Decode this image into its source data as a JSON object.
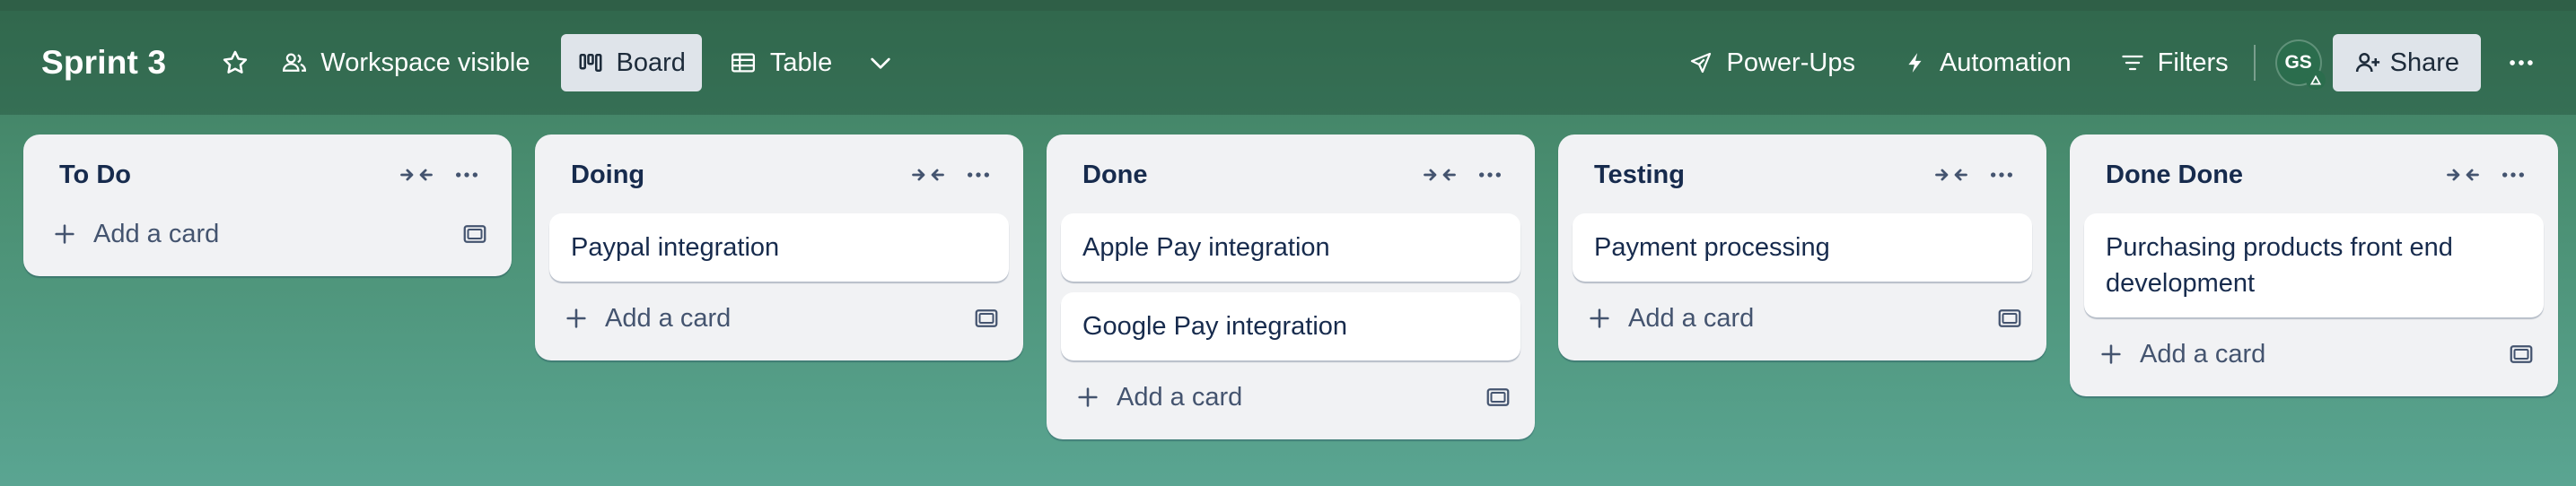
{
  "header": {
    "board_title": "Sprint 3",
    "visibility_label": "Workspace visible",
    "views": [
      {
        "label": "Board",
        "active": true
      },
      {
        "label": "Table",
        "active": false
      }
    ],
    "power_ups_label": "Power-Ups",
    "automation_label": "Automation",
    "filters_label": "Filters",
    "avatar_initials": "GS",
    "share_label": "Share"
  },
  "lists": [
    {
      "title": "To Do",
      "cards": [],
      "add_label": "Add a card"
    },
    {
      "title": "Doing",
      "cards": [
        "Paypal integration"
      ],
      "add_label": "Add a card"
    },
    {
      "title": "Done",
      "cards": [
        "Apple Pay integration",
        "Google Pay integration"
      ],
      "add_label": "Add a card"
    },
    {
      "title": "Testing",
      "cards": [
        "Payment processing"
      ],
      "add_label": "Add a card"
    },
    {
      "title": "Done Done",
      "cards": [
        "Purchasing products front end development"
      ],
      "add_label": "Add a card"
    }
  ],
  "colors": {
    "background": "#4a8f72",
    "list_bg": "#f1f2f4",
    "card_bg": "#ffffff",
    "text_primary": "#172b4d"
  }
}
